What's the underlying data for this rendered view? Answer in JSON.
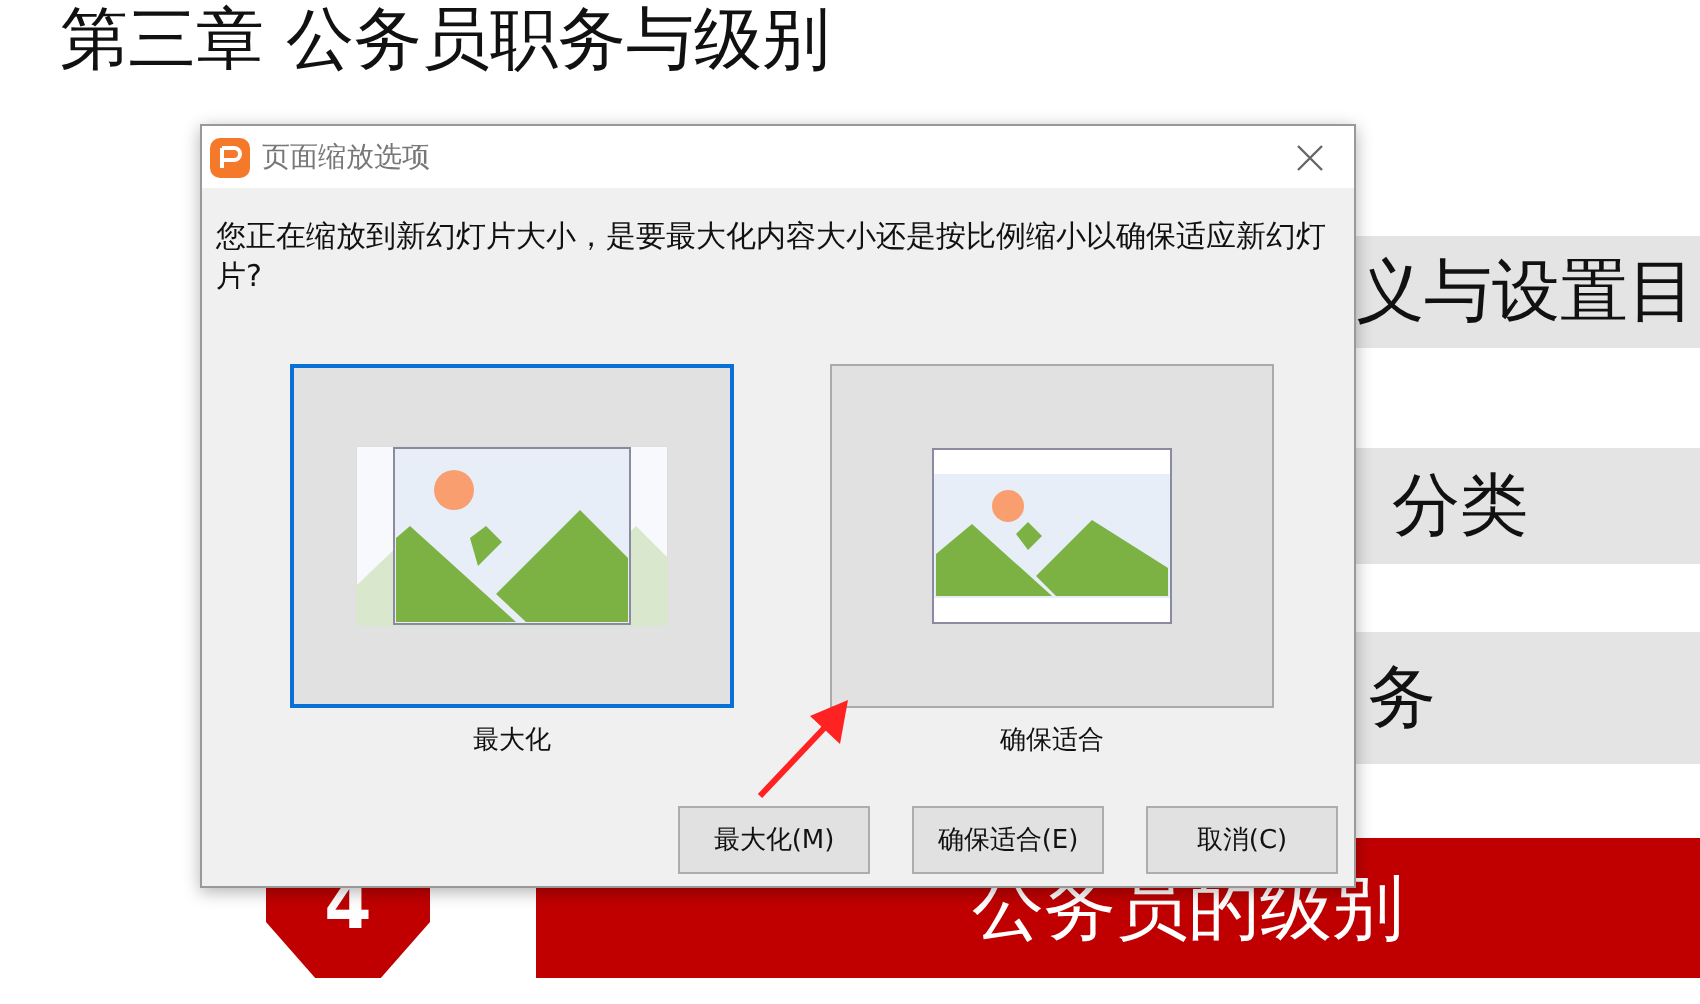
{
  "slide": {
    "title": "第三章 公务员职务与级别",
    "rows": [
      {
        "text": "义与设置目",
        "kind": "plain"
      },
      {
        "text": "分类",
        "kind": "plain"
      },
      {
        "text": "务",
        "kind": "plain"
      },
      {
        "text": "公务员的级别",
        "kind": "numbered",
        "number": "4"
      }
    ]
  },
  "dialog": {
    "title": "页面缩放选项",
    "message": "您正在缩放到新幻灯片大小，是要最大化内容大小还是按比例缩小以确保适应新幻灯片?",
    "options": [
      {
        "label": "最大化",
        "kind": "maximize",
        "selected": true
      },
      {
        "label": "确保适合",
        "kind": "fit",
        "selected": false
      }
    ],
    "buttons": [
      "最大化(M)",
      "确保适合(E)",
      "取消(C)"
    ]
  }
}
